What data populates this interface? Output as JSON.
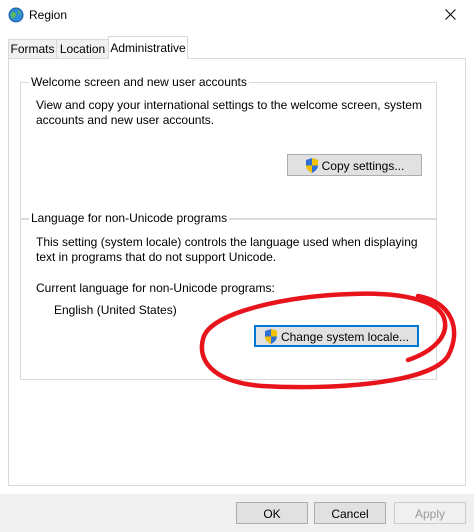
{
  "window": {
    "title": "Region",
    "icon": "globe-icon",
    "close_icon": "close-icon"
  },
  "tabs": [
    {
      "label": "Formats",
      "active": false
    },
    {
      "label": "Location",
      "active": false
    },
    {
      "label": "Administrative",
      "active": true
    }
  ],
  "welcome_group": {
    "title": "Welcome screen and new user accounts",
    "description": "View and copy your international settings to the welcome screen, system accounts and new user accounts.",
    "description_line1": "View and copy your international settings to the welcome screen, system",
    "description_line2": "accounts and new user accounts.",
    "copy_button": "Copy settings..."
  },
  "language_group": {
    "title": "Language for non-Unicode programs",
    "description_line1": "This setting (system locale) controls the language used when displaying",
    "description_line2": "text in programs that do not support Unicode.",
    "current_label": "Current language for non-Unicode programs:",
    "current_value": "English (United States)",
    "change_button": "Change system locale..."
  },
  "footer": {
    "ok": "OK",
    "cancel": "Cancel",
    "apply": "Apply"
  },
  "colors": {
    "annotation": "#e8141c",
    "focus": "#0078d7"
  }
}
